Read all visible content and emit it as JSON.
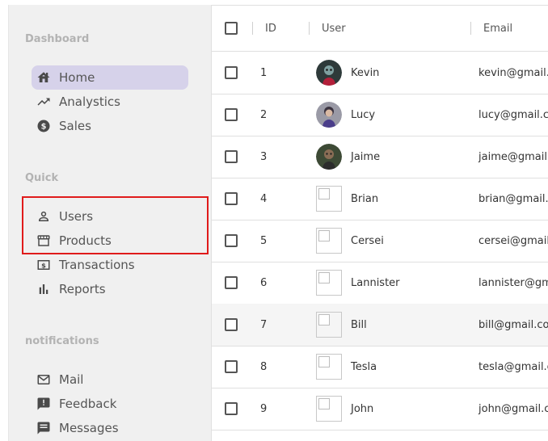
{
  "sidebar": {
    "sections": [
      {
        "title": "Dashboard",
        "items": [
          {
            "label": "Home",
            "icon": "home-icon",
            "active": true
          },
          {
            "label": "Analystics",
            "icon": "trending-up-icon"
          },
          {
            "label": "Sales",
            "icon": "dollar-icon"
          }
        ]
      },
      {
        "title": "Quick",
        "items": [
          {
            "label": "Users",
            "icon": "user-icon"
          },
          {
            "label": "Products",
            "icon": "storefront-icon"
          },
          {
            "label": "Transactions",
            "icon": "money-icon"
          },
          {
            "label": "Reports",
            "icon": "bar-chart-icon"
          }
        ]
      },
      {
        "title": "notifications",
        "items": [
          {
            "label": "Mail",
            "icon": "mail-icon"
          },
          {
            "label": "Feedback",
            "icon": "feedback-icon"
          },
          {
            "label": "Messages",
            "icon": "message-icon"
          }
        ]
      }
    ]
  },
  "table": {
    "columns": [
      "ID",
      "User",
      "Email"
    ],
    "rows": [
      {
        "id": "1",
        "user": "Kevin",
        "email": "kevin@gmail.com",
        "avatar": "photo"
      },
      {
        "id": "2",
        "user": "Lucy",
        "email": "lucy@gmail.com",
        "avatar": "photo"
      },
      {
        "id": "3",
        "user": "Jaime",
        "email": "jaime@gmail.com",
        "avatar": "photo"
      },
      {
        "id": "4",
        "user": "Brian",
        "email": "brian@gmail.com",
        "avatar": "broken"
      },
      {
        "id": "5",
        "user": "Cersei",
        "email": "cersei@gmail.com",
        "avatar": "broken"
      },
      {
        "id": "6",
        "user": "Lannister",
        "email": "lannister@gmail.com",
        "avatar": "broken"
      },
      {
        "id": "7",
        "user": "Bill",
        "email": "bill@gmail.com",
        "avatar": "broken"
      },
      {
        "id": "8",
        "user": "Tesla",
        "email": "tesla@gmail.com",
        "avatar": "broken"
      },
      {
        "id": "9",
        "user": "John",
        "email": "john@gmail.com",
        "avatar": "broken"
      }
    ]
  },
  "colors": {
    "active_nav_bg": "#d6d2ea",
    "highlight_border": "#e01b1b",
    "sidebar_bg": "#f0f0f0"
  }
}
